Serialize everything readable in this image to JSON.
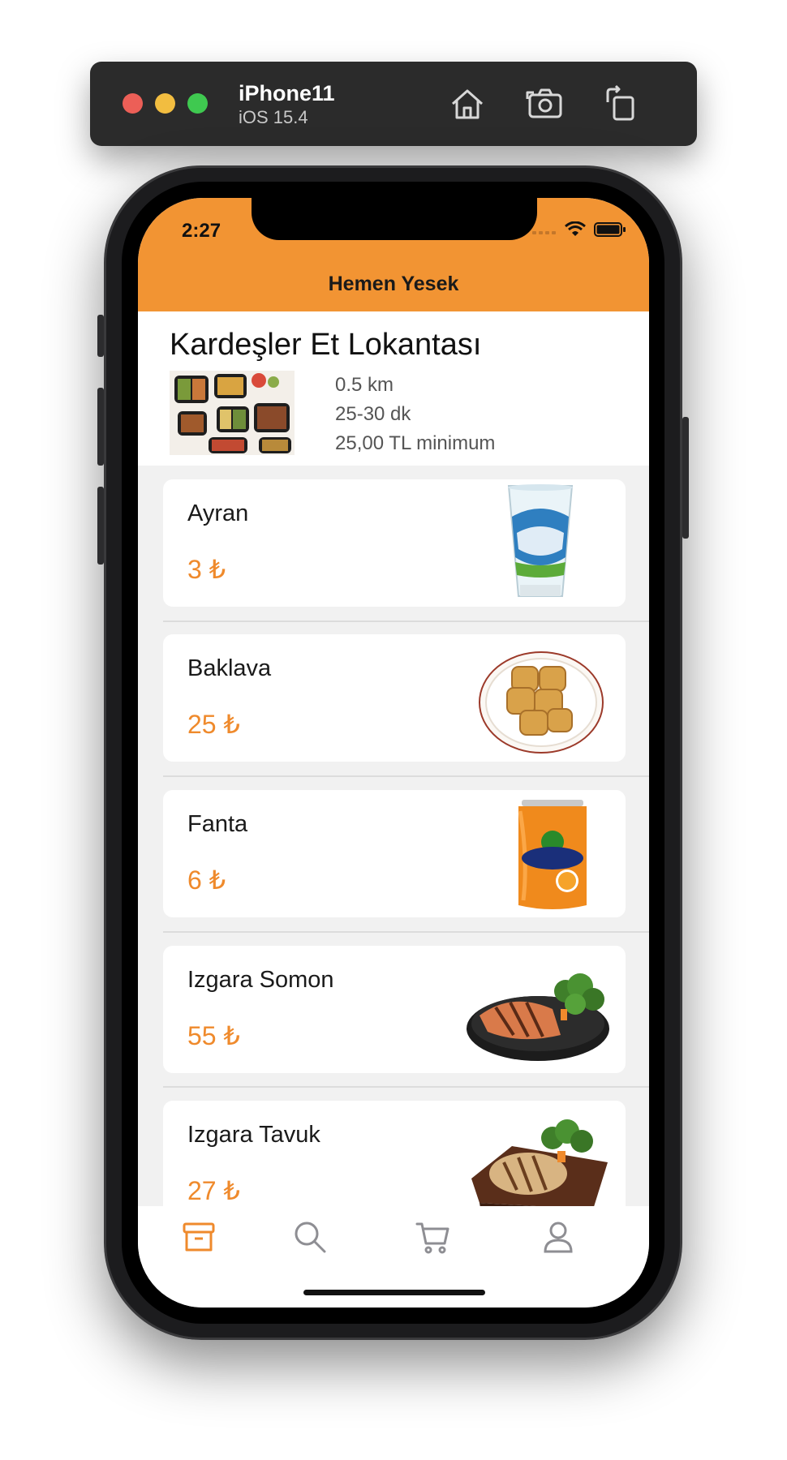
{
  "simulator": {
    "device_name": "iPhone11",
    "os_version": "iOS 15.4",
    "toolbar_icons": [
      "home-icon",
      "screenshot-icon",
      "rotate-icon"
    ]
  },
  "status_bar": {
    "time": "2:27",
    "icons": [
      "signal-icon",
      "wifi-icon",
      "battery-icon"
    ]
  },
  "nav": {
    "title": "Hemen Yesek",
    "bar_color": "#f29433"
  },
  "restaurant": {
    "name": "Kardeşler Et Lokantası",
    "distance": "0.5 km",
    "delivery_time": "25-30 dk",
    "minimum_order": "25,00 TL minimum"
  },
  "menu_items": [
    {
      "name": "Ayran",
      "price": "3 ₺",
      "image": "ayran-cup-image"
    },
    {
      "name": "Baklava",
      "price": "25 ₺",
      "image": "baklava-plate-image"
    },
    {
      "name": "Fanta",
      "price": "6 ₺",
      "image": "fanta-can-image"
    },
    {
      "name": "Izgara Somon",
      "price": "55 ₺",
      "image": "grilled-salmon-image"
    },
    {
      "name": "Izgara Tavuk",
      "price": "27 ₺",
      "image": "grilled-chicken-image"
    }
  ],
  "tab_bar": {
    "tabs": [
      "store-tab",
      "search-tab",
      "cart-tab",
      "profile-tab"
    ],
    "active": "store-tab",
    "active_color": "#ef8a2c",
    "inactive_color": "#8e8e93"
  }
}
